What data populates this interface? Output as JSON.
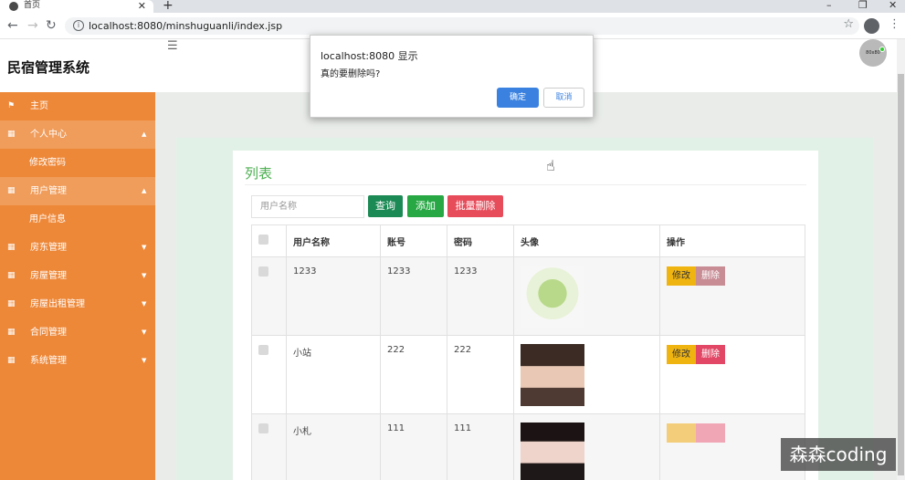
{
  "browser": {
    "tab_title": "首页",
    "tab_close": "✕",
    "new_tab": "+",
    "url": "localhost:8080/minshuguanli/index.jsp"
  },
  "header": {
    "app_title": "民宿管理系统",
    "avatar_text": "80x80"
  },
  "sidebar": {
    "items": [
      {
        "label": "主页",
        "icon": "flag-icon"
      },
      {
        "label": "个人中心",
        "icon": "grid-icon",
        "arrow": "caret-up-icon"
      },
      {
        "label": "修改密码"
      },
      {
        "label": "用户管理",
        "icon": "grid-icon",
        "arrow": "caret-up-icon"
      },
      {
        "label": "用户信息"
      },
      {
        "label": "房东管理",
        "icon": "grid-icon",
        "arrow": "caret-down-icon"
      },
      {
        "label": "房屋管理",
        "icon": "grid-icon",
        "arrow": "caret-down-icon"
      },
      {
        "label": "房屋出租管理",
        "icon": "grid-icon",
        "arrow": "caret-down-icon"
      },
      {
        "label": "合同管理",
        "icon": "grid-icon",
        "arrow": "caret-down-icon"
      },
      {
        "label": "系统管理",
        "icon": "grid-icon",
        "arrow": "caret-down-icon"
      }
    ]
  },
  "main": {
    "card_title": "列表",
    "search_placeholder": "用户名称",
    "btn_query": "查询",
    "btn_add": "添加",
    "btn_bulk_delete": "批量删除",
    "columns": [
      "用户名称",
      "账号",
      "密码",
      "头像",
      "操作"
    ],
    "rows": [
      {
        "name": "1233",
        "account": "1233",
        "password": "1233",
        "avatar": "avatar-1"
      },
      {
        "name": "小站",
        "account": "222",
        "password": "222",
        "avatar": "avatar-2"
      },
      {
        "name": "小札",
        "account": "111",
        "password": "111",
        "avatar": "avatar-3"
      }
    ],
    "edit_label": "修改",
    "delete_label": "删除"
  },
  "dialog": {
    "title": "localhost:8080 显示",
    "message": "真的要删除吗?",
    "ok": "确定",
    "cancel": "取消"
  },
  "watermark": "森森coding",
  "colors": {
    "sidebar": "#ee8839",
    "accent_green": "#4caf50",
    "query": "#1c8a55",
    "add": "#28a745",
    "danger": "#e74c5b",
    "edit": "#f0b411",
    "dialog_ok": "#3b82e0"
  }
}
